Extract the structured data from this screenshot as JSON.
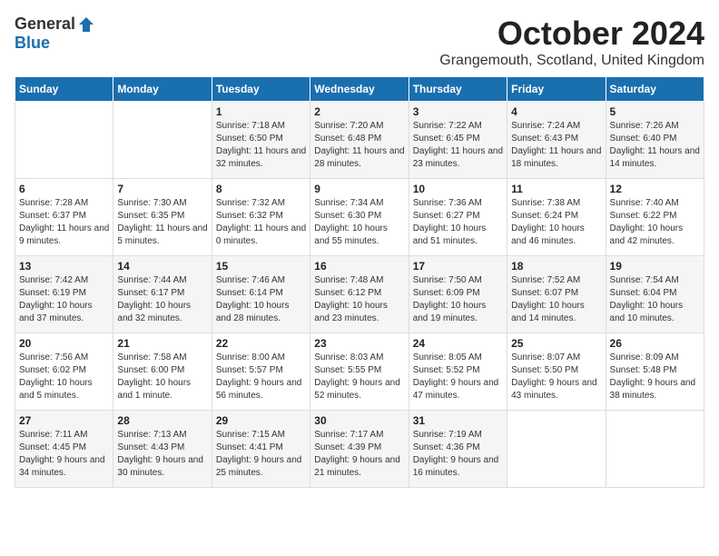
{
  "logo": {
    "general": "General",
    "blue": "Blue"
  },
  "header": {
    "month": "October 2024",
    "location": "Grangemouth, Scotland, United Kingdom"
  },
  "weekdays": [
    "Sunday",
    "Monday",
    "Tuesday",
    "Wednesday",
    "Thursday",
    "Friday",
    "Saturday"
  ],
  "weeks": [
    [
      {
        "day": "",
        "sunrise": "",
        "sunset": "",
        "daylight": ""
      },
      {
        "day": "",
        "sunrise": "",
        "sunset": "",
        "daylight": ""
      },
      {
        "day": "1",
        "sunrise": "Sunrise: 7:18 AM",
        "sunset": "Sunset: 6:50 PM",
        "daylight": "Daylight: 11 hours and 32 minutes."
      },
      {
        "day": "2",
        "sunrise": "Sunrise: 7:20 AM",
        "sunset": "Sunset: 6:48 PM",
        "daylight": "Daylight: 11 hours and 28 minutes."
      },
      {
        "day": "3",
        "sunrise": "Sunrise: 7:22 AM",
        "sunset": "Sunset: 6:45 PM",
        "daylight": "Daylight: 11 hours and 23 minutes."
      },
      {
        "day": "4",
        "sunrise": "Sunrise: 7:24 AM",
        "sunset": "Sunset: 6:43 PM",
        "daylight": "Daylight: 11 hours and 18 minutes."
      },
      {
        "day": "5",
        "sunrise": "Sunrise: 7:26 AM",
        "sunset": "Sunset: 6:40 PM",
        "daylight": "Daylight: 11 hours and 14 minutes."
      }
    ],
    [
      {
        "day": "6",
        "sunrise": "Sunrise: 7:28 AM",
        "sunset": "Sunset: 6:37 PM",
        "daylight": "Daylight: 11 hours and 9 minutes."
      },
      {
        "day": "7",
        "sunrise": "Sunrise: 7:30 AM",
        "sunset": "Sunset: 6:35 PM",
        "daylight": "Daylight: 11 hours and 5 minutes."
      },
      {
        "day": "8",
        "sunrise": "Sunrise: 7:32 AM",
        "sunset": "Sunset: 6:32 PM",
        "daylight": "Daylight: 11 hours and 0 minutes."
      },
      {
        "day": "9",
        "sunrise": "Sunrise: 7:34 AM",
        "sunset": "Sunset: 6:30 PM",
        "daylight": "Daylight: 10 hours and 55 minutes."
      },
      {
        "day": "10",
        "sunrise": "Sunrise: 7:36 AM",
        "sunset": "Sunset: 6:27 PM",
        "daylight": "Daylight: 10 hours and 51 minutes."
      },
      {
        "day": "11",
        "sunrise": "Sunrise: 7:38 AM",
        "sunset": "Sunset: 6:24 PM",
        "daylight": "Daylight: 10 hours and 46 minutes."
      },
      {
        "day": "12",
        "sunrise": "Sunrise: 7:40 AM",
        "sunset": "Sunset: 6:22 PM",
        "daylight": "Daylight: 10 hours and 42 minutes."
      }
    ],
    [
      {
        "day": "13",
        "sunrise": "Sunrise: 7:42 AM",
        "sunset": "Sunset: 6:19 PM",
        "daylight": "Daylight: 10 hours and 37 minutes."
      },
      {
        "day": "14",
        "sunrise": "Sunrise: 7:44 AM",
        "sunset": "Sunset: 6:17 PM",
        "daylight": "Daylight: 10 hours and 32 minutes."
      },
      {
        "day": "15",
        "sunrise": "Sunrise: 7:46 AM",
        "sunset": "Sunset: 6:14 PM",
        "daylight": "Daylight: 10 hours and 28 minutes."
      },
      {
        "day": "16",
        "sunrise": "Sunrise: 7:48 AM",
        "sunset": "Sunset: 6:12 PM",
        "daylight": "Daylight: 10 hours and 23 minutes."
      },
      {
        "day": "17",
        "sunrise": "Sunrise: 7:50 AM",
        "sunset": "Sunset: 6:09 PM",
        "daylight": "Daylight: 10 hours and 19 minutes."
      },
      {
        "day": "18",
        "sunrise": "Sunrise: 7:52 AM",
        "sunset": "Sunset: 6:07 PM",
        "daylight": "Daylight: 10 hours and 14 minutes."
      },
      {
        "day": "19",
        "sunrise": "Sunrise: 7:54 AM",
        "sunset": "Sunset: 6:04 PM",
        "daylight": "Daylight: 10 hours and 10 minutes."
      }
    ],
    [
      {
        "day": "20",
        "sunrise": "Sunrise: 7:56 AM",
        "sunset": "Sunset: 6:02 PM",
        "daylight": "Daylight: 10 hours and 5 minutes."
      },
      {
        "day": "21",
        "sunrise": "Sunrise: 7:58 AM",
        "sunset": "Sunset: 6:00 PM",
        "daylight": "Daylight: 10 hours and 1 minute."
      },
      {
        "day": "22",
        "sunrise": "Sunrise: 8:00 AM",
        "sunset": "Sunset: 5:57 PM",
        "daylight": "Daylight: 9 hours and 56 minutes."
      },
      {
        "day": "23",
        "sunrise": "Sunrise: 8:03 AM",
        "sunset": "Sunset: 5:55 PM",
        "daylight": "Daylight: 9 hours and 52 minutes."
      },
      {
        "day": "24",
        "sunrise": "Sunrise: 8:05 AM",
        "sunset": "Sunset: 5:52 PM",
        "daylight": "Daylight: 9 hours and 47 minutes."
      },
      {
        "day": "25",
        "sunrise": "Sunrise: 8:07 AM",
        "sunset": "Sunset: 5:50 PM",
        "daylight": "Daylight: 9 hours and 43 minutes."
      },
      {
        "day": "26",
        "sunrise": "Sunrise: 8:09 AM",
        "sunset": "Sunset: 5:48 PM",
        "daylight": "Daylight: 9 hours and 38 minutes."
      }
    ],
    [
      {
        "day": "27",
        "sunrise": "Sunrise: 7:11 AM",
        "sunset": "Sunset: 4:45 PM",
        "daylight": "Daylight: 9 hours and 34 minutes."
      },
      {
        "day": "28",
        "sunrise": "Sunrise: 7:13 AM",
        "sunset": "Sunset: 4:43 PM",
        "daylight": "Daylight: 9 hours and 30 minutes."
      },
      {
        "day": "29",
        "sunrise": "Sunrise: 7:15 AM",
        "sunset": "Sunset: 4:41 PM",
        "daylight": "Daylight: 9 hours and 25 minutes."
      },
      {
        "day": "30",
        "sunrise": "Sunrise: 7:17 AM",
        "sunset": "Sunset: 4:39 PM",
        "daylight": "Daylight: 9 hours and 21 minutes."
      },
      {
        "day": "31",
        "sunrise": "Sunrise: 7:19 AM",
        "sunset": "Sunset: 4:36 PM",
        "daylight": "Daylight: 9 hours and 16 minutes."
      },
      {
        "day": "",
        "sunrise": "",
        "sunset": "",
        "daylight": ""
      },
      {
        "day": "",
        "sunrise": "",
        "sunset": "",
        "daylight": ""
      }
    ]
  ]
}
